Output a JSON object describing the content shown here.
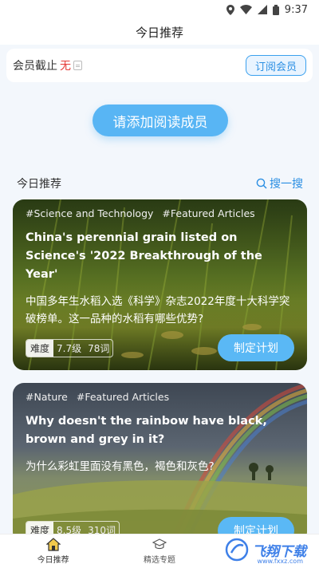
{
  "status_bar": {
    "time": "9:37"
  },
  "header": {
    "title": "今日推荐"
  },
  "membership": {
    "label": "会员截止",
    "value": "无",
    "subscribe_label": "订阅会员"
  },
  "add_reader_label": "请添加阅读成员",
  "section": {
    "title": "今日推荐",
    "search_label": "搜一搜"
  },
  "articles": [
    {
      "tags": [
        "#Science and Technology",
        "#Featured Articles"
      ],
      "title_en": "China's perennial grain listed on Science's '2022 Breakthrough of the Year'",
      "title_zh": "中国多年生水稻入选《科学》杂志2022年度十大科学突破榜单。这一品种的水稻有哪些优势?",
      "difficulty_label": "难度",
      "level": "7.7级",
      "words": "78词",
      "plan_label": "制定计划"
    },
    {
      "tags": [
        "#Nature",
        "#Featured Articles"
      ],
      "title_en": "Why doesn't the rainbow have black, brown and grey in it?",
      "title_zh": "为什么彩虹里面没有黑色，褐色和灰色?",
      "difficulty_label": "难度",
      "level": "8.5级",
      "words": "310词",
      "plan_label": "制定计划"
    }
  ],
  "bottom_nav": [
    {
      "label": "今日推荐",
      "icon": "home-icon"
    },
    {
      "label": "精选专题",
      "icon": "graduation-cap-icon"
    },
    {
      "label": "",
      "icon": ""
    }
  ],
  "watermark": {
    "text": "飞翔下载",
    "sub": "www.fxxz.com"
  },
  "colors": {
    "accent": "#58b5f4",
    "accent_text": "#2b8fe3",
    "expired": "#e53935",
    "background": "#f3f7fc"
  }
}
